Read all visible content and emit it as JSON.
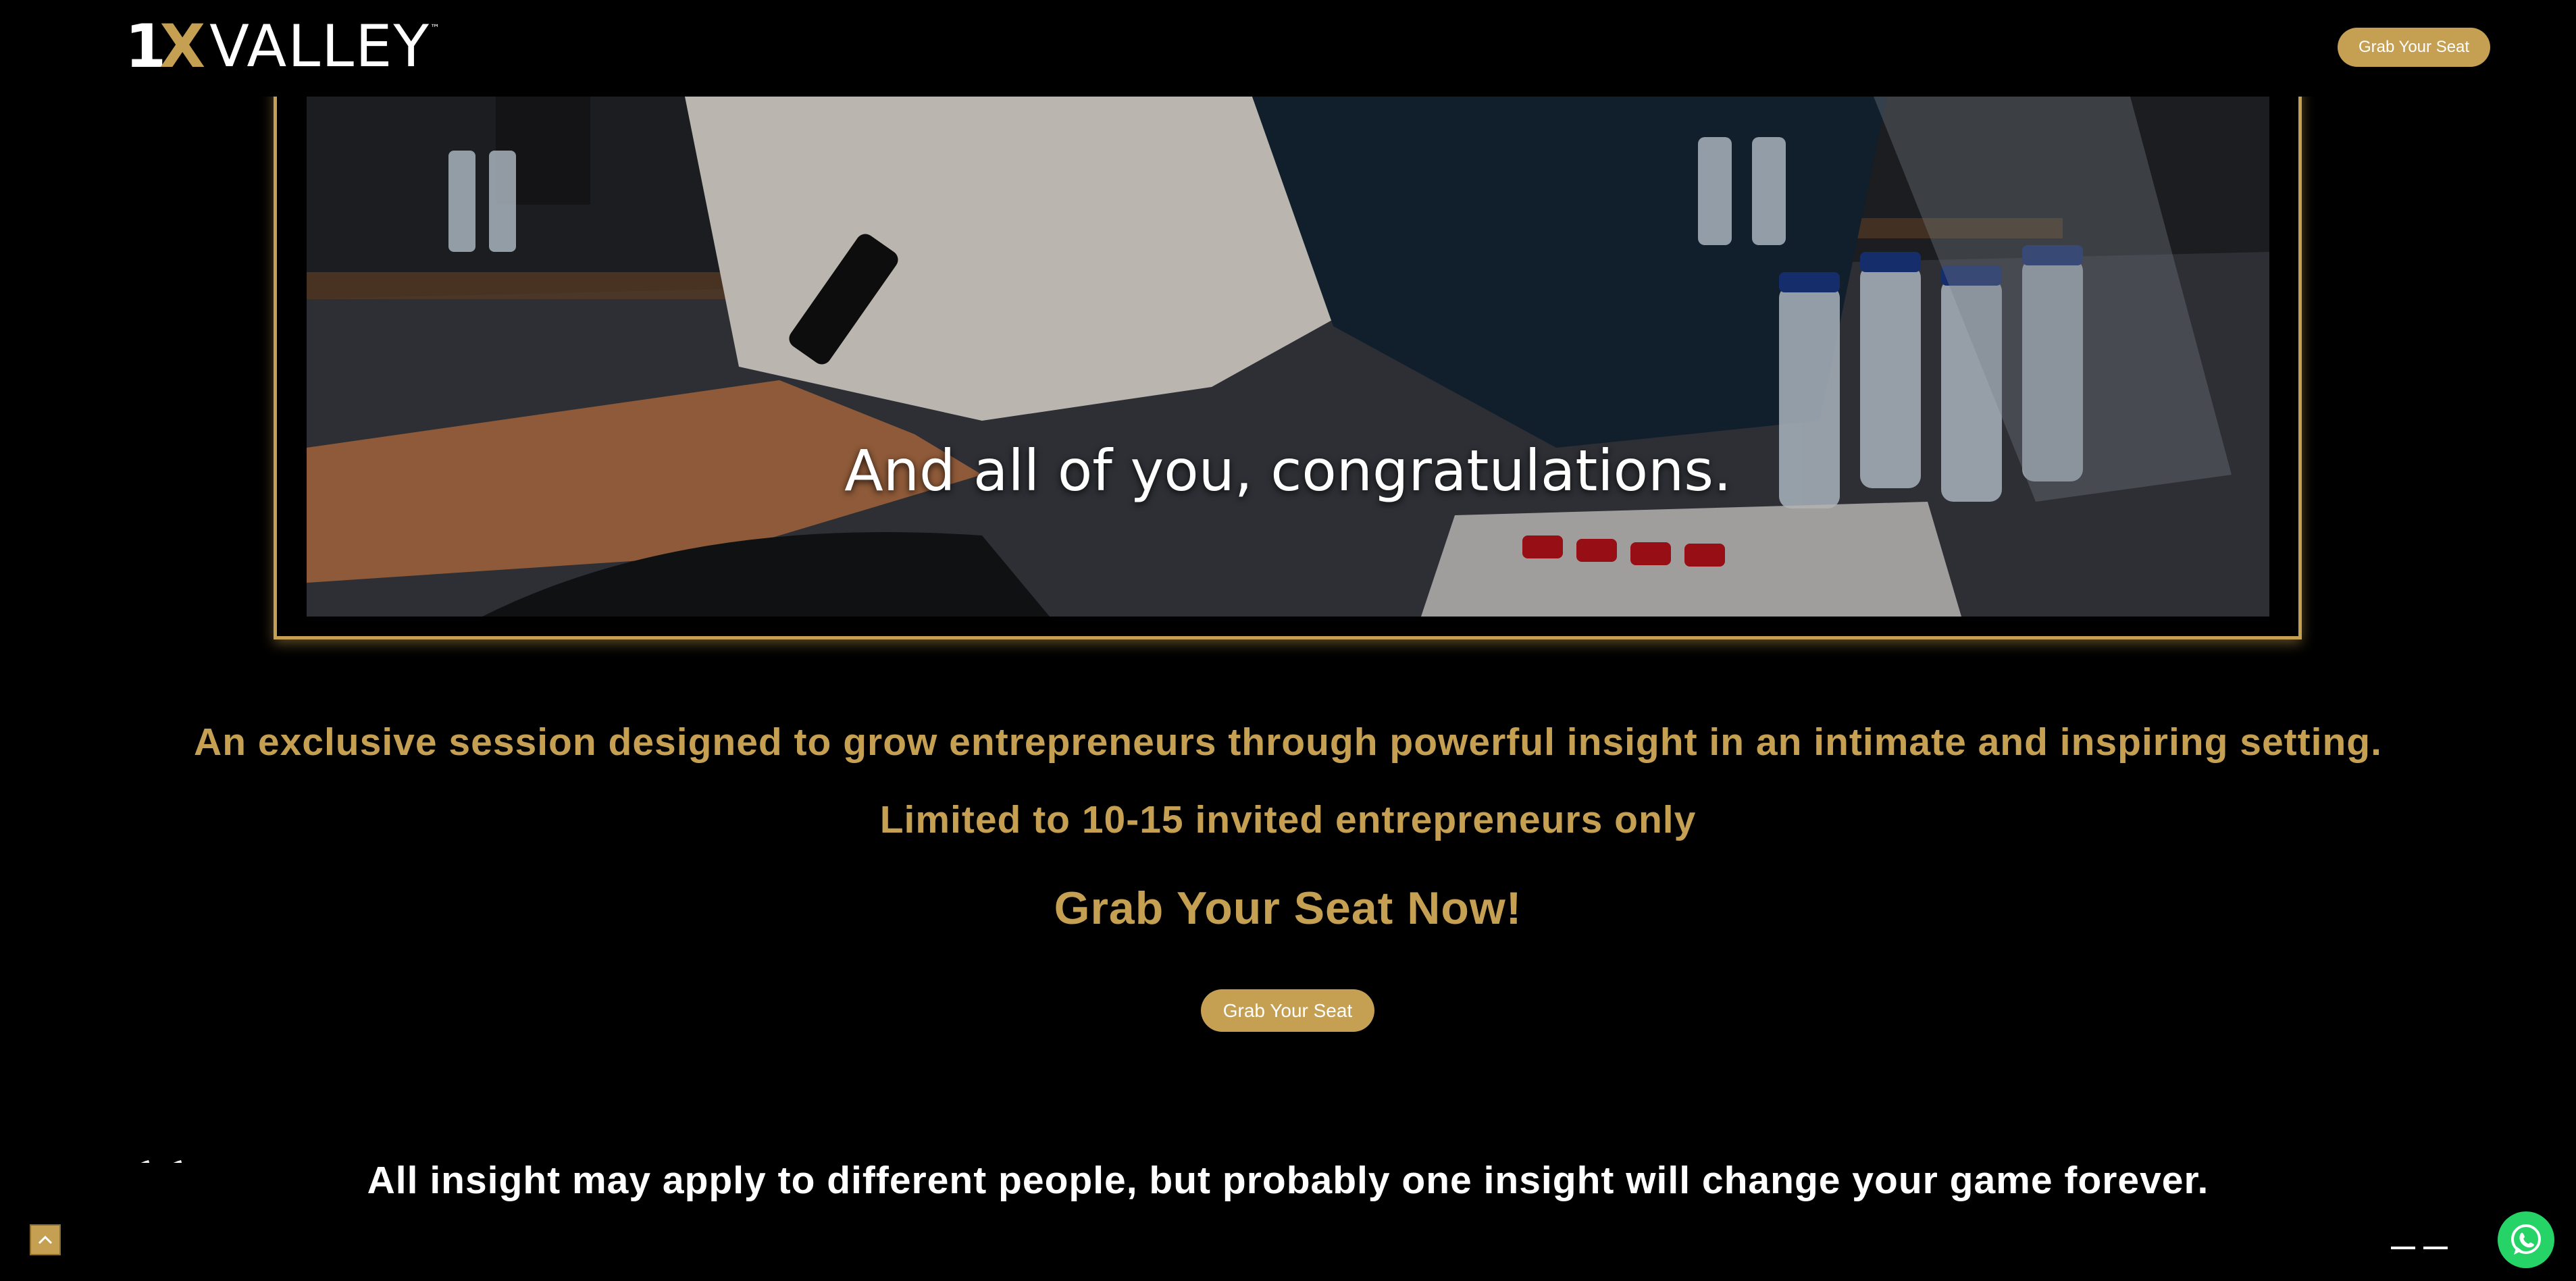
{
  "header": {
    "logo_one": "1",
    "logo_x": "X",
    "logo_rest": "VALLEY",
    "logo_tm": "™",
    "cta_label": "Grab Your Seat"
  },
  "video": {
    "caption": "And all of you, congratulations."
  },
  "content": {
    "tagline": "An exclusive session designed to grow entrepreneurs through powerful insight in an intimate and inspiring setting.",
    "limited": "Limited to 10-15 invited entrepreneurs only",
    "cta_heading": "Grab Your Seat Now!",
    "cta_label": "Grab Your Seat"
  },
  "quote": {
    "open_mark": "“",
    "close_mark": "”",
    "text": "All insight may apply to different people, but probably one insight will change your game forever."
  },
  "floating": {
    "scroll_top_icon": "chevron-up-icon",
    "whatsapp_icon": "whatsapp-icon"
  },
  "colors": {
    "accent": "#c6a052",
    "background": "#000000",
    "whatsapp": "#25d366"
  }
}
